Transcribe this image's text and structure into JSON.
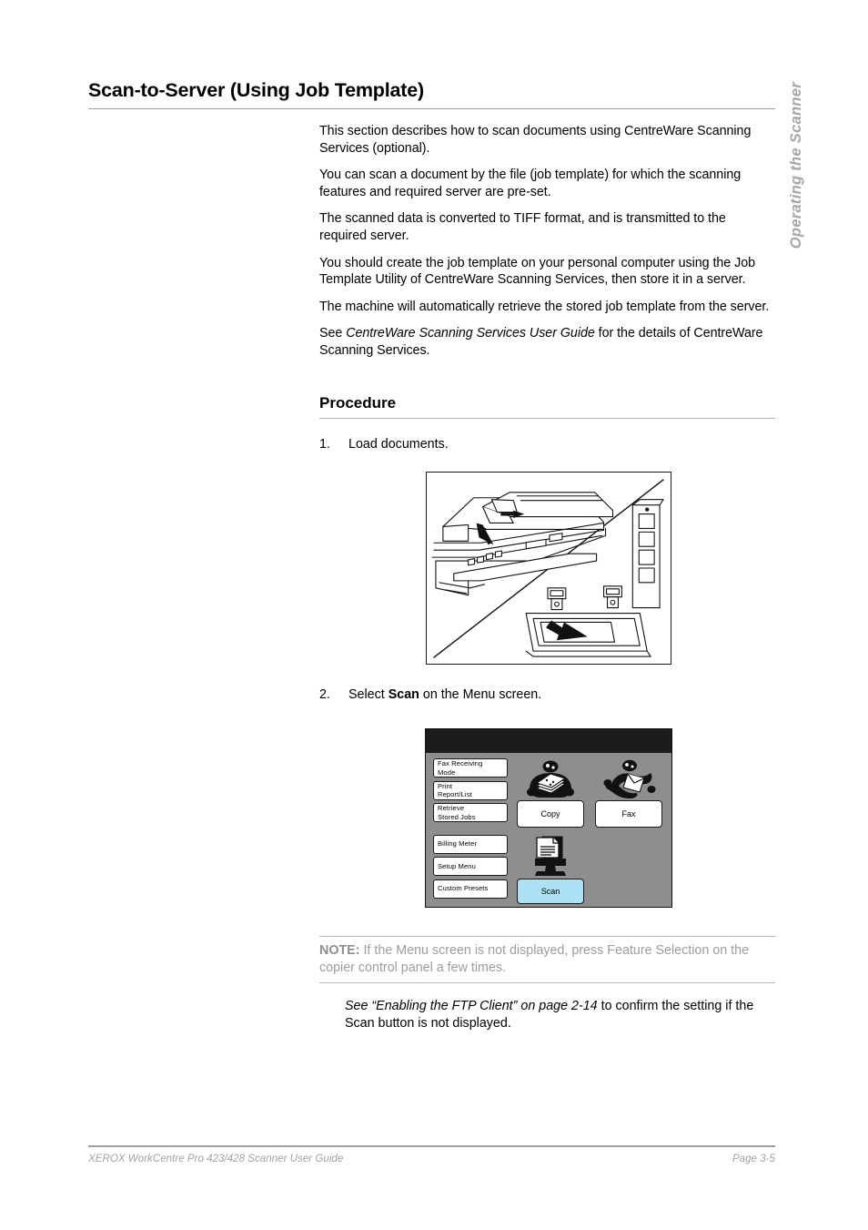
{
  "side_tab": {
    "label": "Operating the Scanner"
  },
  "heading": {
    "title": "Scan-to-Server (Using Job Template)"
  },
  "intro": {
    "paragraphs": [
      "This section describes how to scan documents using CentreWare Scanning Services (optional).",
      "You can scan a document by the file (job template) for which the scanning features and required server are pre-set.",
      "The scanned data is converted to TIFF format, and is transmitted to the required server.",
      "You should create the job template on your personal computer using the Job Template Utility of CentreWare Scanning Services, then store it in a server.",
      "The machine will automatically retrieve the stored job template from the server."
    ],
    "see_prefix": "See ",
    "see_italic": "CentreWare Scanning Services User Guide",
    "see_suffix": " for the details of CentreWare Scanning Services."
  },
  "procedure": {
    "title": "Procedure",
    "steps": [
      {
        "number": "1.",
        "text": "Load documents."
      },
      {
        "number": "2.",
        "text_before": "Select ",
        "text_bold": "Scan",
        "text_after": " on the Menu screen."
      }
    ]
  },
  "figure_copier": {
    "caption": "copier-document-feeder-and-platen-illustration"
  },
  "touch_panel": {
    "left_buttons": [
      {
        "line1": "Fax Receiving",
        "line2": "Mode"
      },
      {
        "line1": "Print",
        "line2": "Report/List"
      },
      {
        "line1": "Retrieve",
        "line2": "Stored Jobs"
      },
      {
        "line1": "Billing Meter",
        "line2": ""
      },
      {
        "line1": "Setup Menu",
        "line2": ""
      },
      {
        "line1": "Custom Presets",
        "line2": ""
      }
    ],
    "main_buttons": [
      {
        "label": "Copy",
        "icon": "copy-person-documents-icon",
        "selected": false
      },
      {
        "label": "Fax",
        "icon": "fax-person-envelope-icon",
        "selected": false
      },
      {
        "label": "Scan",
        "icon": "scan-document-monitor-icon",
        "selected": true
      }
    ],
    "selected_color": "#ade2f4",
    "panel_background": "#8e8e8e",
    "titlebar_color": "#1c1c1c"
  },
  "note": {
    "label": "NOTE:",
    "text": " If the Menu screen is not displayed, press Feature Selection on the copier control panel a few times."
  },
  "after_note": {
    "italic": "See “Enabling the FTP Client” on page 2-14",
    "rest": " to confirm the setting if the Scan button is not displayed."
  },
  "footer": {
    "left": "XEROX WorkCentre Pro 423/428 Scanner User Guide",
    "right": "Page 3-5"
  }
}
